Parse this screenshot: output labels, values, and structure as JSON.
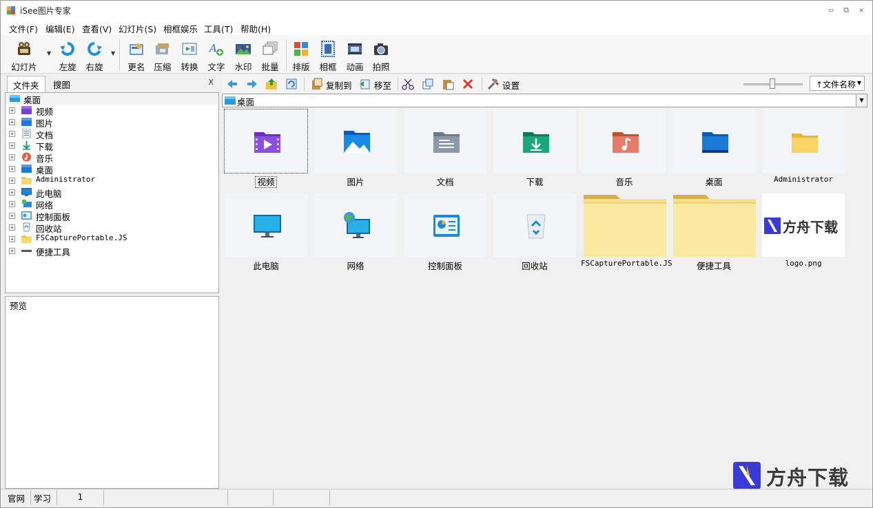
{
  "app": {
    "title": "iSee图片专家"
  },
  "window_controls": {
    "minimize": "▭",
    "restore": "⧉",
    "close": "✕"
  },
  "menu": [
    "文件(F)",
    "编辑(E)",
    "查看(V)",
    "幻灯片(S)",
    "相框娱乐",
    "工具(T)",
    "帮助(H)"
  ],
  "toolbar": [
    {
      "id": "slideshow",
      "label": "幻灯片",
      "icon": "film-reel-icon",
      "color": "#5a3b1a"
    },
    {
      "id": "rotate-left",
      "label": "左旋",
      "icon": "rotate-left-icon",
      "color": "#1e90d6"
    },
    {
      "id": "rotate-right",
      "label": "右旋",
      "icon": "rotate-right-icon",
      "color": "#1e90d6"
    },
    {
      "id": "rename",
      "label": "更名",
      "icon": "rename-icon",
      "color": "#3a7bc8"
    },
    {
      "id": "compress",
      "label": "压缩",
      "icon": "compress-icon",
      "color": "#7a8a9a"
    },
    {
      "id": "convert",
      "label": "转换",
      "icon": "convert-icon",
      "color": "#3a9a5a"
    },
    {
      "id": "text",
      "label": "文字",
      "icon": "text-icon",
      "color": "#2a6ab8"
    },
    {
      "id": "watermark",
      "label": "水印",
      "icon": "watermark-icon",
      "color": "#c83a2a"
    },
    {
      "id": "batch",
      "label": "批量",
      "icon": "batch-icon",
      "color": "#8a8a8a"
    },
    {
      "id": "layout",
      "label": "排版",
      "icon": "layout-icon",
      "color": "#e0a020"
    },
    {
      "id": "frame",
      "label": "相框",
      "icon": "frame-icon",
      "color": "#3a6ab8"
    },
    {
      "id": "animation",
      "label": "动画",
      "icon": "animation-icon",
      "color": "#4a6a9a"
    },
    {
      "id": "capture",
      "label": "拍照",
      "icon": "camera-icon",
      "color": "#3a3a4a"
    }
  ],
  "left_panel": {
    "tabs": [
      "文件夹",
      "搜图"
    ],
    "close_label": "X",
    "root": {
      "label": "桌面",
      "icon": "desktop-icon"
    },
    "tree": [
      {
        "label": "视频",
        "icon": "video-folder-icon",
        "color": "#7a3fd0"
      },
      {
        "label": "图片",
        "icon": "pictures-folder-icon",
        "color": "#1a7ad8"
      },
      {
        "label": "文档",
        "icon": "documents-folder-icon",
        "color": "#8a9aaa"
      },
      {
        "label": "下载",
        "icon": "download-folder-icon",
        "color": "#1a9a6a"
      },
      {
        "label": "音乐",
        "icon": "music-folder-icon",
        "color": "#e06040"
      },
      {
        "label": "桌面",
        "icon": "desktop-folder-icon",
        "color": "#1a7ad8"
      },
      {
        "label": "Administrator",
        "icon": "user-folder-icon",
        "color": "#f5c542",
        "mono": true
      },
      {
        "label": "此电脑",
        "icon": "computer-icon",
        "color": "#1a8ad8"
      },
      {
        "label": "网络",
        "icon": "network-icon",
        "color": "#2a8ad8"
      },
      {
        "label": "控制面板",
        "icon": "control-panel-icon",
        "color": "#3a9ad8"
      },
      {
        "label": "回收站",
        "icon": "recycle-bin-icon",
        "color": "#2a8ad8"
      },
      {
        "label": "FSCapturePortable.JS",
        "icon": "folder-icon",
        "color": "#f5c542",
        "mono": true
      },
      {
        "label": "便捷工具",
        "icon": "tools-folder-icon",
        "color": "#555555"
      }
    ],
    "preview_title": "预览"
  },
  "right_toolbar": {
    "copy_to": "复制到",
    "move_to": "移至",
    "settings": "设置",
    "sort_label": "↑文件名称"
  },
  "path": {
    "label": "桌面"
  },
  "thumbnails": [
    {
      "label": "视频",
      "kind": "video",
      "selected": true
    },
    {
      "label": "图片",
      "kind": "pictures"
    },
    {
      "label": "文档",
      "kind": "documents"
    },
    {
      "label": "下载",
      "kind": "download"
    },
    {
      "label": "音乐",
      "kind": "music"
    },
    {
      "label": "桌面",
      "kind": "desktop"
    },
    {
      "label": "Administrator",
      "kind": "folder-small",
      "mono": true
    },
    {
      "label": "此电脑",
      "kind": "computer"
    },
    {
      "label": "网络",
      "kind": "network"
    },
    {
      "label": "控制面板",
      "kind": "control-panel"
    },
    {
      "label": "回收站",
      "kind": "recycle"
    },
    {
      "label": "FSCapturePortable.JS",
      "kind": "folder-large",
      "mono": true
    },
    {
      "label": "便捷工具",
      "kind": "folder-large"
    },
    {
      "label": "logo.png",
      "kind": "logo",
      "mono": true,
      "image_text": "方舟下载"
    }
  ],
  "watermark": {
    "text": "方舟下载"
  },
  "statusbar": [
    "官网",
    "学习",
    "1",
    "",
    "",
    "",
    ""
  ]
}
